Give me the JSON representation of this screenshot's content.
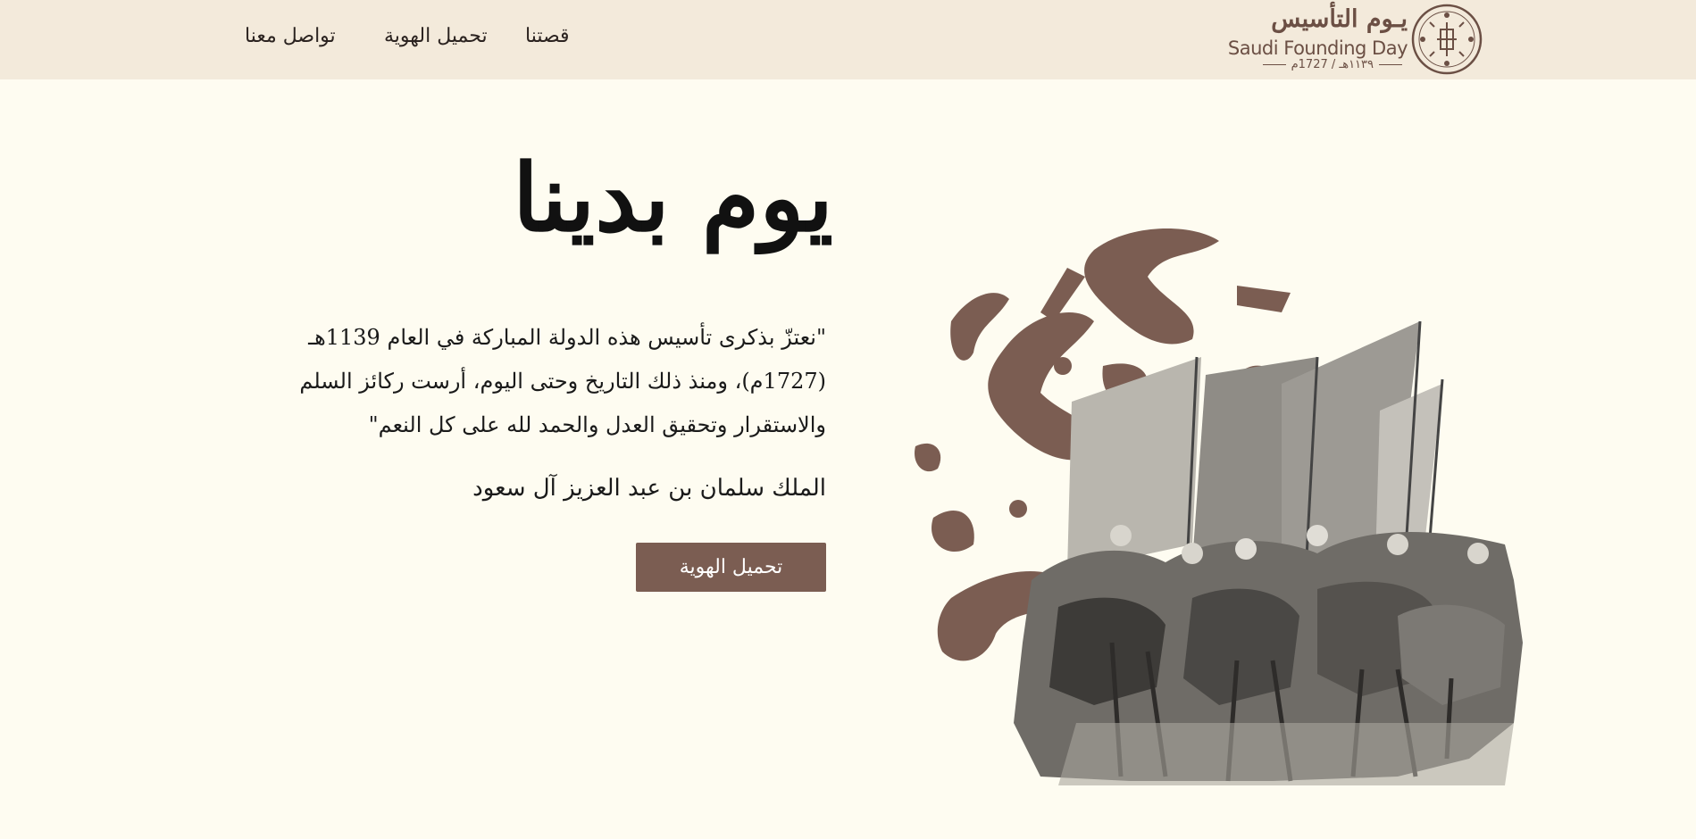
{
  "nav": {
    "items": [
      {
        "label": "قصتنا"
      },
      {
        "label": "تحميل الهوية"
      },
      {
        "label": "تواصل معنا"
      }
    ]
  },
  "logo": {
    "arabic": "يـوم التأسيس",
    "english": "Saudi Founding Day",
    "date": "١١٣٩هـ / 1727م"
  },
  "hero": {
    "title": "يوم بدينا",
    "quote": "\"نعتزّ بذكرى تأسيس هذه الدولة المباركة في العام 1139هـ (1727م)، ومنذ ذلك التاريخ وحتى اليوم، أرست ركائز السلم والاستقرار وتحقيق العدل والحمد لله على كل النعم\"",
    "author": "الملك سلمان بن عبد العزيز آل سعود",
    "cta_label": "تحميل الهوية"
  },
  "colors": {
    "page_bg": "#fefcf1",
    "header_bg": "#f3eadb",
    "brand_brown": "#7b5d52",
    "logo_brown": "#6b4f44"
  },
  "icons": {
    "logo": "founding-day-emblem-icon",
    "artwork": "camel-riders-with-flags-photo"
  }
}
